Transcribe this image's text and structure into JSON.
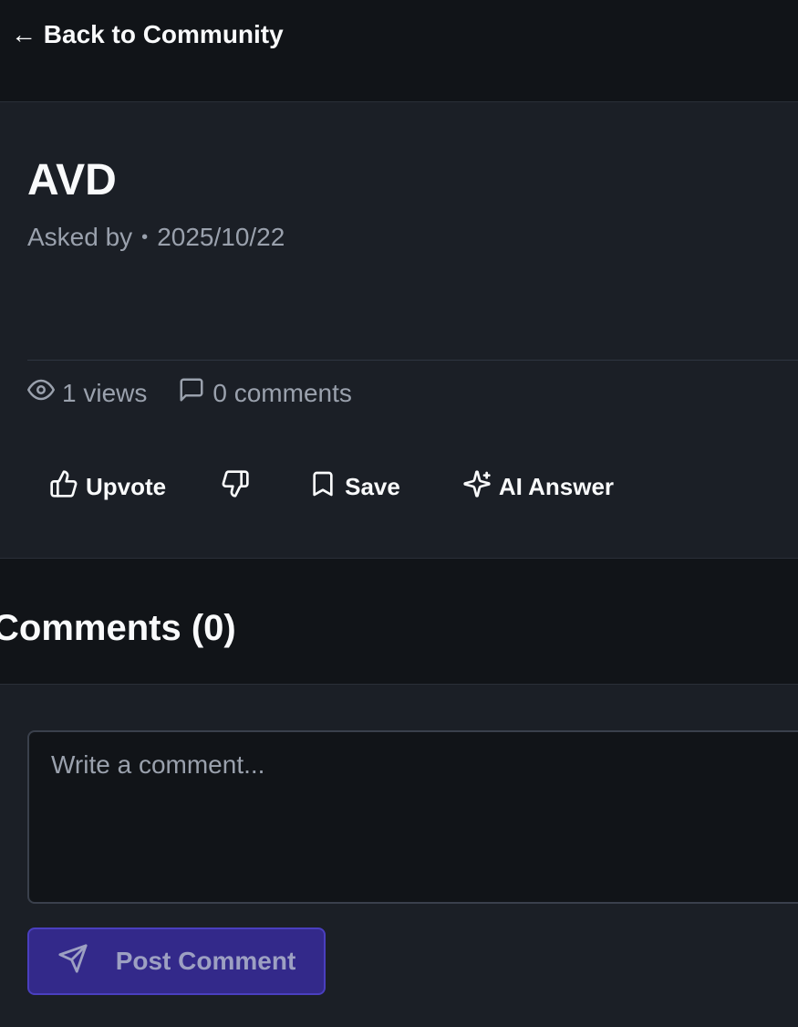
{
  "nav": {
    "back_label": "← Back to Community"
  },
  "post": {
    "title": "AVD",
    "asked_by_label": "Asked by",
    "separator": "•",
    "date": "2025/10/22",
    "views": "1 views",
    "comments_count": "0 comments"
  },
  "actions": {
    "upvote_label": "Upvote",
    "save_label": "Save",
    "ai_answer_label": "AI Answer"
  },
  "comments": {
    "title": "Comments (0)",
    "input_placeholder": "Write a comment...",
    "post_button_label": "Post Comment"
  },
  "icons": {
    "views": "eye-icon",
    "comments": "comment-icon",
    "upvote": "thumbs-up-icon",
    "downvote": "thumbs-down-icon",
    "save": "bookmark-icon",
    "ai_answer": "sparkles-icon",
    "post": "send-icon"
  },
  "colors": {
    "background": "#111418",
    "card": "#1b1f26",
    "text": "#f9fafb",
    "muted": "#9aa1ad",
    "accent": "#33298a"
  }
}
